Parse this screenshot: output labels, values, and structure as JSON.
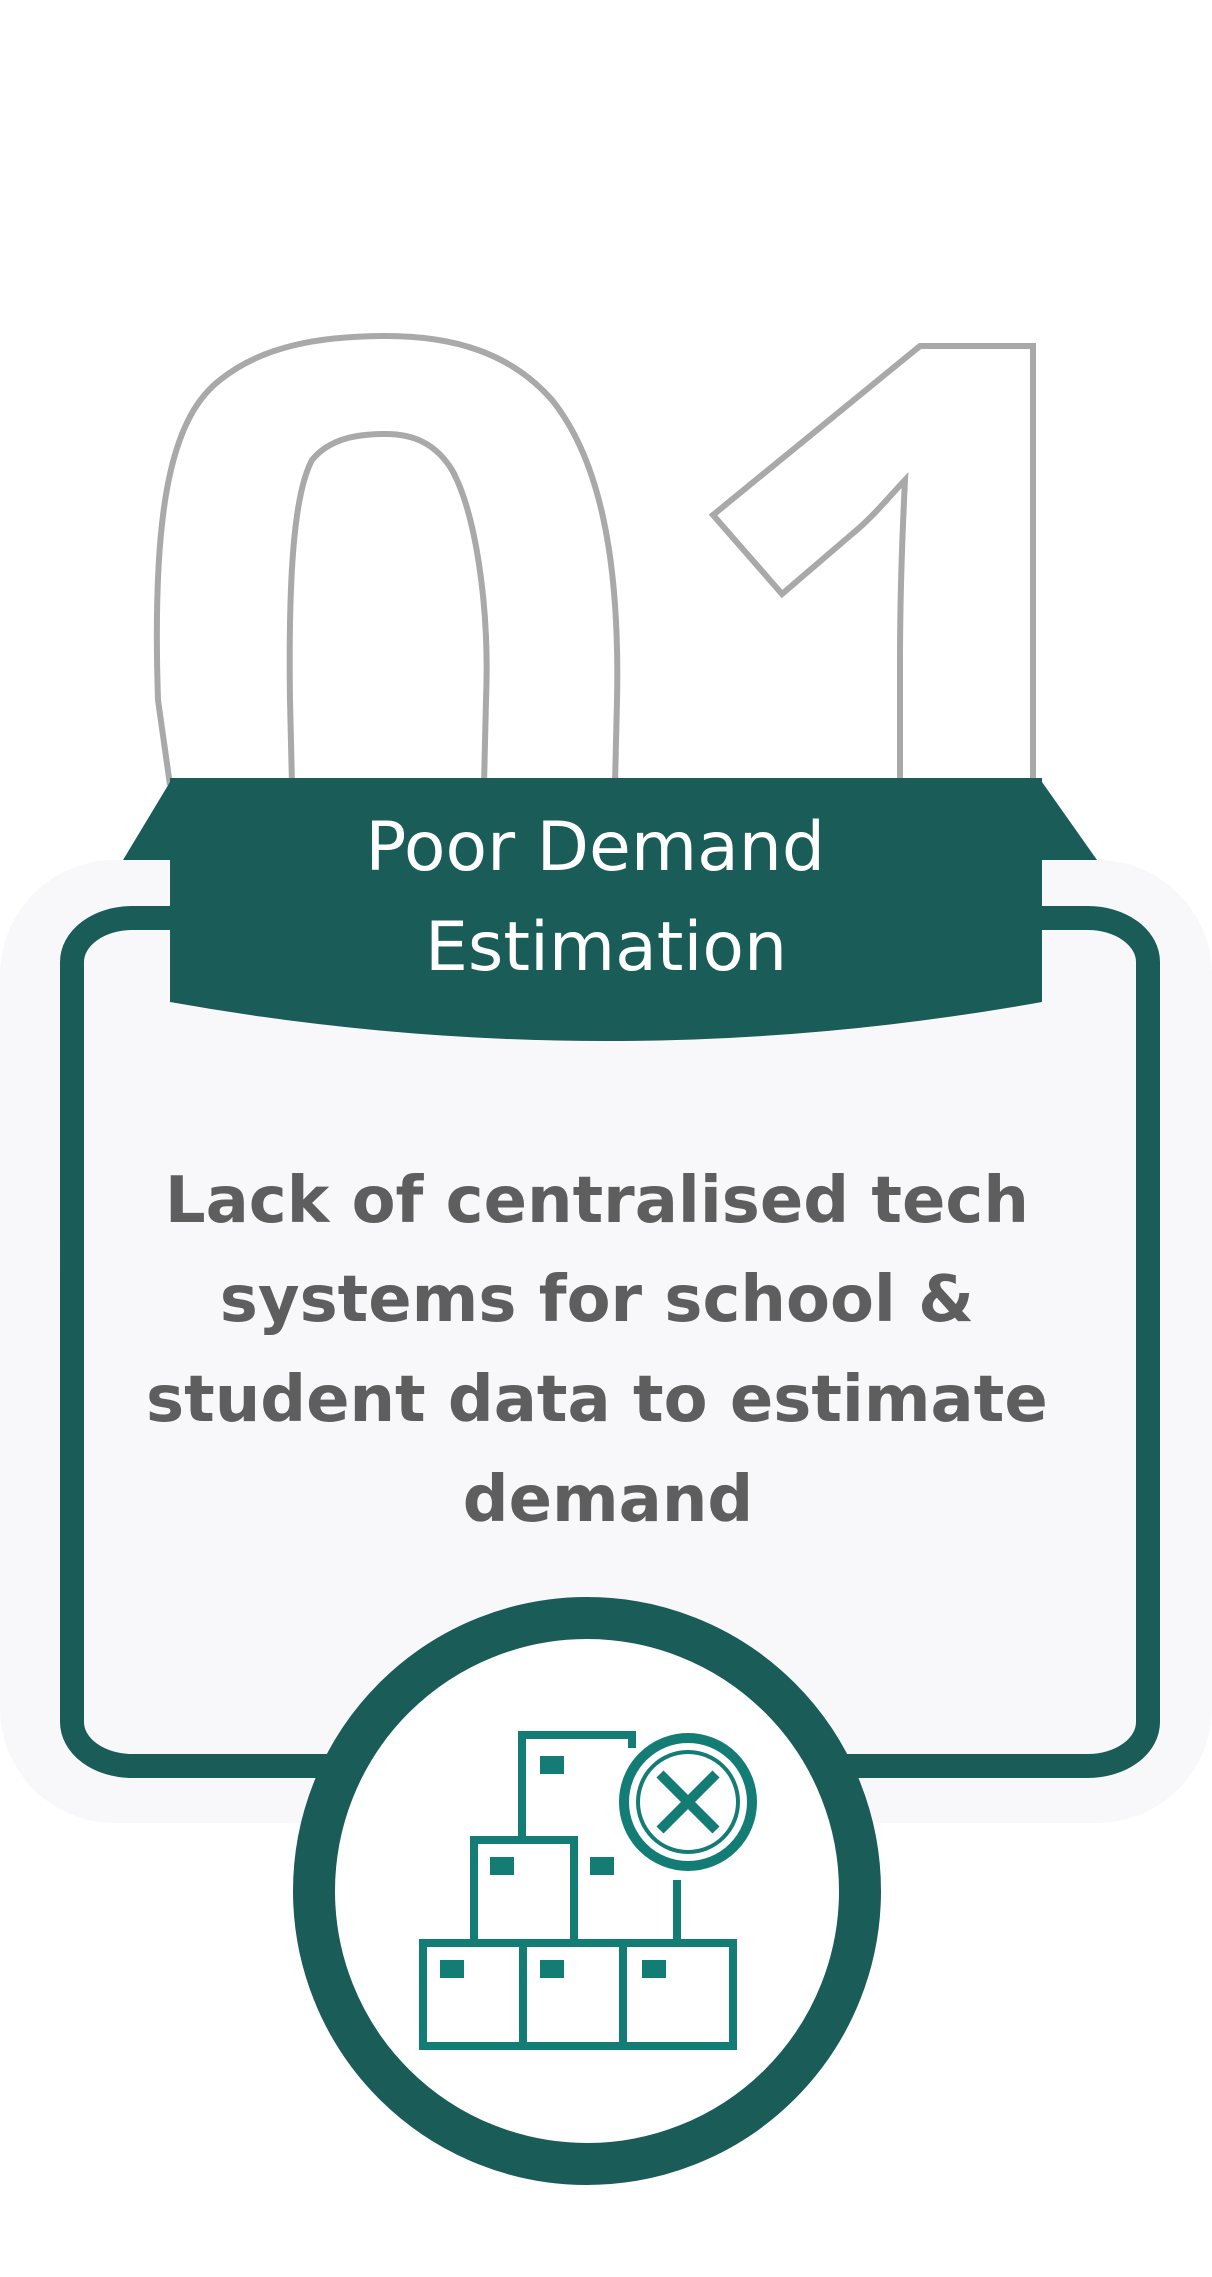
{
  "card": {
    "number": "01",
    "title": "Poor Demand Estimation",
    "title_lines": [
      "Poor Demand",
      "Estimation"
    ],
    "description_lines": [
      "Lack of centralised tech",
      "systems for school &",
      "student data to estimate",
      "demand"
    ],
    "icon": "boxes-stack-cross-icon"
  },
  "colors": {
    "accent": "#1a5c57",
    "icon_teal": "#137c74",
    "text": "#5e5e5e",
    "panel": "#f8f8fb",
    "number_outline": "#a9a9a9"
  }
}
